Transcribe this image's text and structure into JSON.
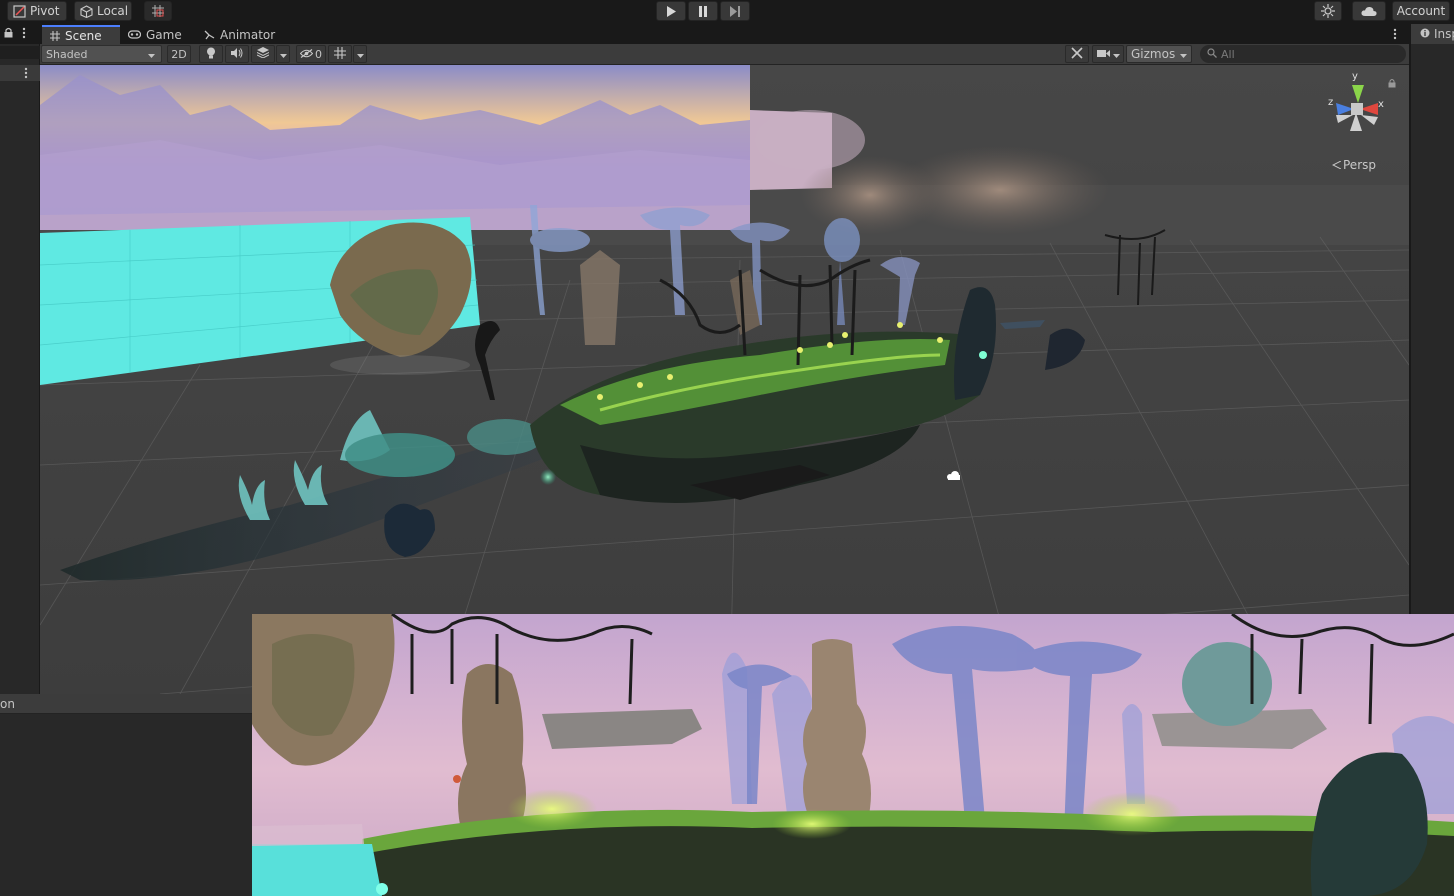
{
  "toolbar": {
    "pivot_label": "Pivot",
    "local_label": "Local",
    "account_label": "Account",
    "icons": [
      "pivot-icon",
      "local-cube-icon",
      "grid-snap-icon",
      "play-icon",
      "pause-icon",
      "step-icon",
      "services-icon",
      "cloud-icon"
    ]
  },
  "scene_tabs": [
    {
      "label": "Scene",
      "icon": "hash-icon",
      "active": true
    },
    {
      "label": "Game",
      "icon": "gamepad-icon",
      "active": false
    },
    {
      "label": "Animator",
      "icon": "animator-icon",
      "active": false
    }
  ],
  "scene_toolbar": {
    "draw_mode": "Shaded",
    "two_d_label": "2D",
    "hidden_count": "0",
    "gizmos_label": "Gizmos",
    "search_placeholder": "All"
  },
  "viewport": {
    "gizmo_axes": {
      "y": "y",
      "x": "x",
      "z": "z"
    },
    "projection_label": "Persp"
  },
  "inspector": {
    "tab_label": "Insp"
  },
  "bottom_panel": {
    "header_label": "on"
  },
  "colors": {
    "accent": "#4c7fff",
    "background": "#191919",
    "panel": "#282828",
    "viewport": "#474747"
  }
}
